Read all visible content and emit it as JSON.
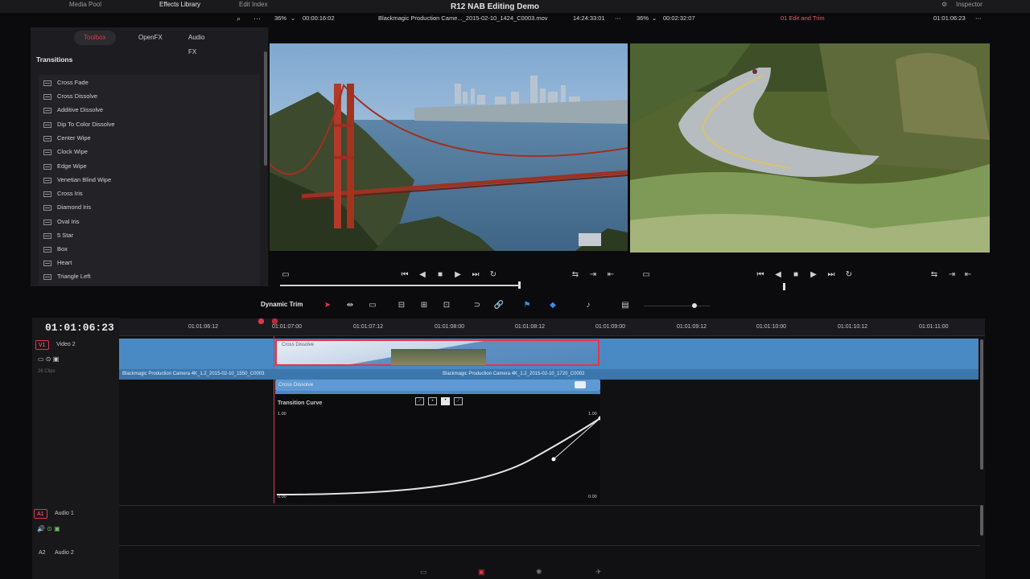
{
  "app": {
    "title": "R12 NAB Editing Demo",
    "top_tabs": [
      "Media Pool",
      "Effects Library",
      "Edit Index"
    ],
    "inspector_label": "Inspector"
  },
  "effects": {
    "tabs": [
      "Toolbox",
      "OpenFX",
      "Audio FX"
    ],
    "active_tab": "Toolbox",
    "section": "Transitions",
    "items": [
      "Cross Fade",
      "Cross Dissolve",
      "Additive Dissolve",
      "Dip To Color Dissolve",
      "Center Wipe",
      "Clock Wipe",
      "Edge Wipe",
      "Venetian Blind Wipe",
      "Cross Iris",
      "Diamond Iris",
      "Oval Iris",
      "5 Star",
      "Box",
      "Heart",
      "Triangle Left"
    ]
  },
  "source_viewer": {
    "zoom": "36%",
    "duration": "00:00:16:02",
    "clip_name": "Blackmagic Production Came..._2015-02-10_1424_C0003.mov",
    "timecode": "14:24:33:01"
  },
  "record_viewer": {
    "zoom": "36%",
    "duration": "00:02:32:07",
    "timeline_name": "01 Edit and Trim",
    "timecode": "01:01:06:23"
  },
  "toolbar": {
    "mode_label": "Dynamic Trim"
  },
  "timeline": {
    "current_timecode": "01:01:06:23",
    "ruler_labels": [
      "01:01:06:12",
      "01:01:07:00",
      "01:01:07:12",
      "01:01:08:00",
      "01:01:08:12",
      "01:01:09:00",
      "01:01:09:12",
      "01:01:10:00",
      "01:01:10:12",
      "01:01:11:00"
    ],
    "video_track": {
      "id": "V1",
      "name": "Video 2",
      "clip_count": "26 Clips"
    },
    "transition_label": "Cross Dissolve",
    "clip_a_name": "Blackmagic Production Camera 4K_1.2_2015-02-10_1550_C0003",
    "clip_b_name": "Blackmagic Production Camera 4K_1.2_2015-02-10_1720_C0002",
    "curve_editor": {
      "header": "Cross Dissolve",
      "title": "Transition Curve",
      "y_top_left": "1.00",
      "y_top_right": "1.00",
      "y_bottom_left": "0.00",
      "y_bottom_right": "0.00"
    },
    "audio_tracks": [
      {
        "id": "A1",
        "name": "Audio 1"
      },
      {
        "id": "A2",
        "name": "Audio 2"
      }
    ]
  }
}
